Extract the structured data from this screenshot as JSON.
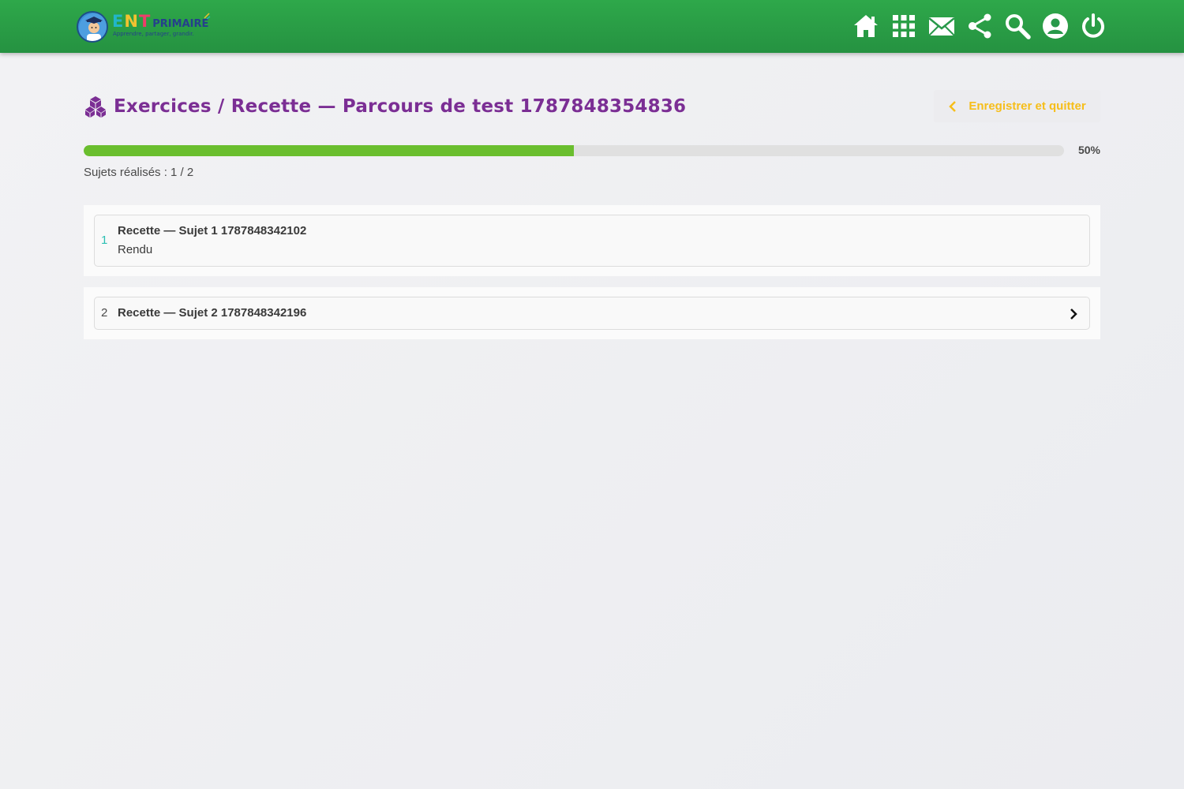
{
  "header": {
    "logo": {
      "brand_e": "E",
      "brand_n": "N",
      "brand_t": "T",
      "brand_suffix": "PRIMAIRE",
      "tagline": "Apprendre, partager, grandir."
    },
    "nav": [
      {
        "name": "home-icon"
      },
      {
        "name": "apps-grid-icon"
      },
      {
        "name": "mail-icon"
      },
      {
        "name": "share-icon"
      },
      {
        "name": "search-icon"
      },
      {
        "name": "user-icon"
      },
      {
        "name": "power-icon"
      }
    ]
  },
  "page": {
    "title": "Exercices / Recette — Parcours de test 1787848354836",
    "save_button": "Enregistrer et quitter",
    "progress": {
      "percent": 50,
      "label": "50%"
    },
    "subjects_done": "Sujets réalisés : 1 / 2",
    "items": [
      {
        "number": "1",
        "title": "Recette — Sujet 1 1787848342102",
        "status": "Rendu"
      },
      {
        "number": "2",
        "title": "Recette — Sujet 2 1787848342196"
      }
    ]
  },
  "colors": {
    "header_green": "#2ea84a",
    "title_purple": "#7b2e94",
    "accent_yellow": "#f6be1a",
    "progress_green": "#6abe2e",
    "done_number_teal": "#2bbfb3"
  }
}
